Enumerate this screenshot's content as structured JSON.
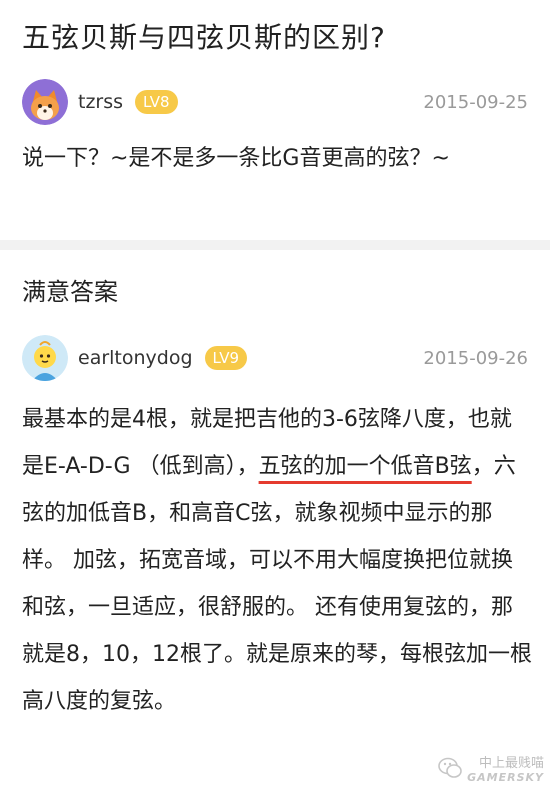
{
  "question": {
    "title": "五弦贝斯与四弦贝斯的区别?",
    "author": {
      "name": "tzrss",
      "level": "LV8",
      "date": "2015-09-25",
      "avatar_icon": "fox-avatar-icon"
    },
    "body": "说一下？~是不是多一条比G音更高的弦？~"
  },
  "answer": {
    "section_title": "满意答案",
    "author": {
      "name": "earltonydog",
      "level": "LV9",
      "date": "2015-09-26",
      "avatar_icon": "baby-avatar-icon"
    },
    "body_before": "最基本的是4根，就是把吉他的3-6弦降八度，也就是E-A-D-G （低到高），",
    "body_marked": "五弦的加一个低音B弦",
    "body_after": "，六弦的加低音B，和高音C弦，就象视频中显示的那样。 加弦，拓宽音域，可以不用大幅度换把位就换和弦，一旦适应，很舒服的。 还有使用复弦的，那就是8，10，12根了。就是原来的琴，每根弦加一根高八度的复弦。"
  },
  "watermark": {
    "text_cn": "中上最贱喵",
    "text_en": "GAMERSKY"
  },
  "colors": {
    "level_badge": "#f7c948",
    "underline": "#e53b2f",
    "date": "#9a9a9a",
    "divider": "#f2f2f2"
  }
}
